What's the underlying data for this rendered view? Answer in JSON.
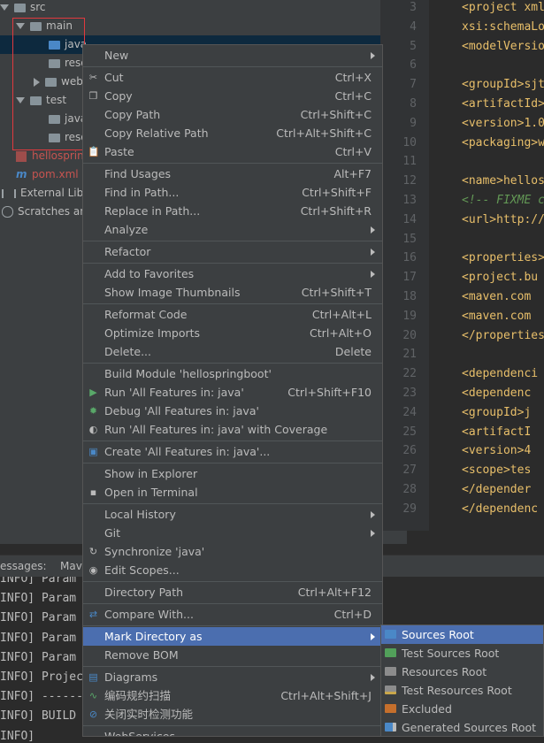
{
  "tree": {
    "items": [
      {
        "label": "src"
      },
      {
        "label": "main"
      },
      {
        "label": "java"
      },
      {
        "label": "reso"
      },
      {
        "label": "web"
      },
      {
        "label": "test"
      },
      {
        "label": "java"
      },
      {
        "label": "reso"
      },
      {
        "label": "hellospring"
      },
      {
        "label": "pom.xml"
      },
      {
        "label": "External Libra"
      },
      {
        "label": "Scratches and"
      }
    ]
  },
  "editor": {
    "line_numbers": [
      "3",
      "4",
      "5",
      "6",
      "7",
      "8",
      "9",
      "10",
      "11",
      "12",
      "13",
      "14",
      "15",
      "16",
      "17",
      "18",
      "19",
      "20",
      "21",
      "22",
      "23",
      "24",
      "25",
      "26",
      "27",
      "28",
      "29"
    ],
    "lines": [
      "<project xmln",
      " xsi:schemaLo",
      " <modelVersio",
      "",
      " <groupId>sjt",
      " <artifactId>",
      " <version>1.0-",
      " <packaging>w",
      "",
      " <name>hellos",
      " <!-- FIXME c",
      " <url>http://w",
      "",
      " <properties>",
      "  <project.bu",
      "  <maven.com",
      "  <maven.com",
      " </properties",
      "",
      " <dependenci",
      "  <dependenc",
      "   <groupId>j",
      "   <artifactI",
      "   <version>4",
      "   <scope>tes",
      "  </depender",
      " </dependenc"
    ]
  },
  "bottom": {
    "tabs": [
      "essages:",
      "Mav"
    ],
    "lines": [
      "INFO] Param",
      "INFO] Param",
      "INFO] Param",
      "INFO] Param",
      "INFO] Param",
      "INFO] Projec",
      "INFO] -------",
      "INFO] BUILD",
      "INFO]"
    ]
  },
  "menu": {
    "new": "New",
    "cut": "Cut",
    "cut_sc": "Ctrl+X",
    "copy": "Copy",
    "copy_sc": "Ctrl+C",
    "copy_path": "Copy Path",
    "copy_path_sc": "Ctrl+Shift+C",
    "copy_rel": "Copy Relative Path",
    "copy_rel_sc": "Ctrl+Alt+Shift+C",
    "paste": "Paste",
    "paste_sc": "Ctrl+V",
    "find_usages": "Find Usages",
    "find_usages_sc": "Alt+F7",
    "find_in_path": "Find in Path...",
    "find_in_path_sc": "Ctrl+Shift+F",
    "replace_in_path": "Replace in Path...",
    "replace_in_path_sc": "Ctrl+Shift+R",
    "analyze": "Analyze",
    "refactor": "Refactor",
    "add_fav": "Add to Favorites",
    "thumbs": "Show Image Thumbnails",
    "thumbs_sc": "Ctrl+Shift+T",
    "reformat": "Reformat Code",
    "reformat_sc": "Ctrl+Alt+L",
    "optimize": "Optimize Imports",
    "optimize_sc": "Ctrl+Alt+O",
    "delete": "Delete...",
    "delete_sc": "Delete",
    "build_module": "Build Module 'hellospringboot'",
    "run": "Run 'All Features in: java'",
    "run_sc": "Ctrl+Shift+F10",
    "debug": "Debug 'All Features in: java'",
    "coverage": "Run 'All Features in: java' with Coverage",
    "create": "Create 'All Features in: java'...",
    "explorer": "Show in Explorer",
    "terminal": "Open in Terminal",
    "local_history": "Local History",
    "git": "Git",
    "synchronize": "Synchronize 'java'",
    "edit_scopes": "Edit Scopes...",
    "dir_path": "Directory Path",
    "dir_path_sc": "Ctrl+Alt+F12",
    "compare": "Compare With...",
    "compare_sc": "Ctrl+D",
    "mark_dir": "Mark Directory as",
    "remove_bom": "Remove BOM",
    "diagrams": "Diagrams",
    "scan": "编码规约扫描",
    "scan_sc": "Ctrl+Alt+Shift+J",
    "close_detect": "关闭实时检测功能",
    "webservices": "WebServices"
  },
  "submenu": {
    "sources_root": "Sources Root",
    "test_sources_root": "Test Sources Root",
    "resources_root": "Resources Root",
    "test_resources_root": "Test Resources Root",
    "excluded": "Excluded",
    "generated_sources_root": "Generated Sources Root"
  },
  "colors": {
    "highlight": "#4b6eaf",
    "folder_blue": "#4a88c7",
    "folder_green": "#52a05a",
    "folder_resources": "#8c8c8c",
    "folder_excluded": "#c56f2c",
    "tree_selection": "#0d293e"
  },
  "icons": [
    "folder-icon",
    "cut-icon",
    "copy-icon",
    "paste-icon",
    "run-icon",
    "debug-icon",
    "coverage-icon",
    "create-icon",
    "terminal-icon",
    "sync-icon",
    "scopes-icon",
    "compare-icon",
    "diagrams-icon",
    "scan-icon",
    "close-detect-icon"
  ]
}
